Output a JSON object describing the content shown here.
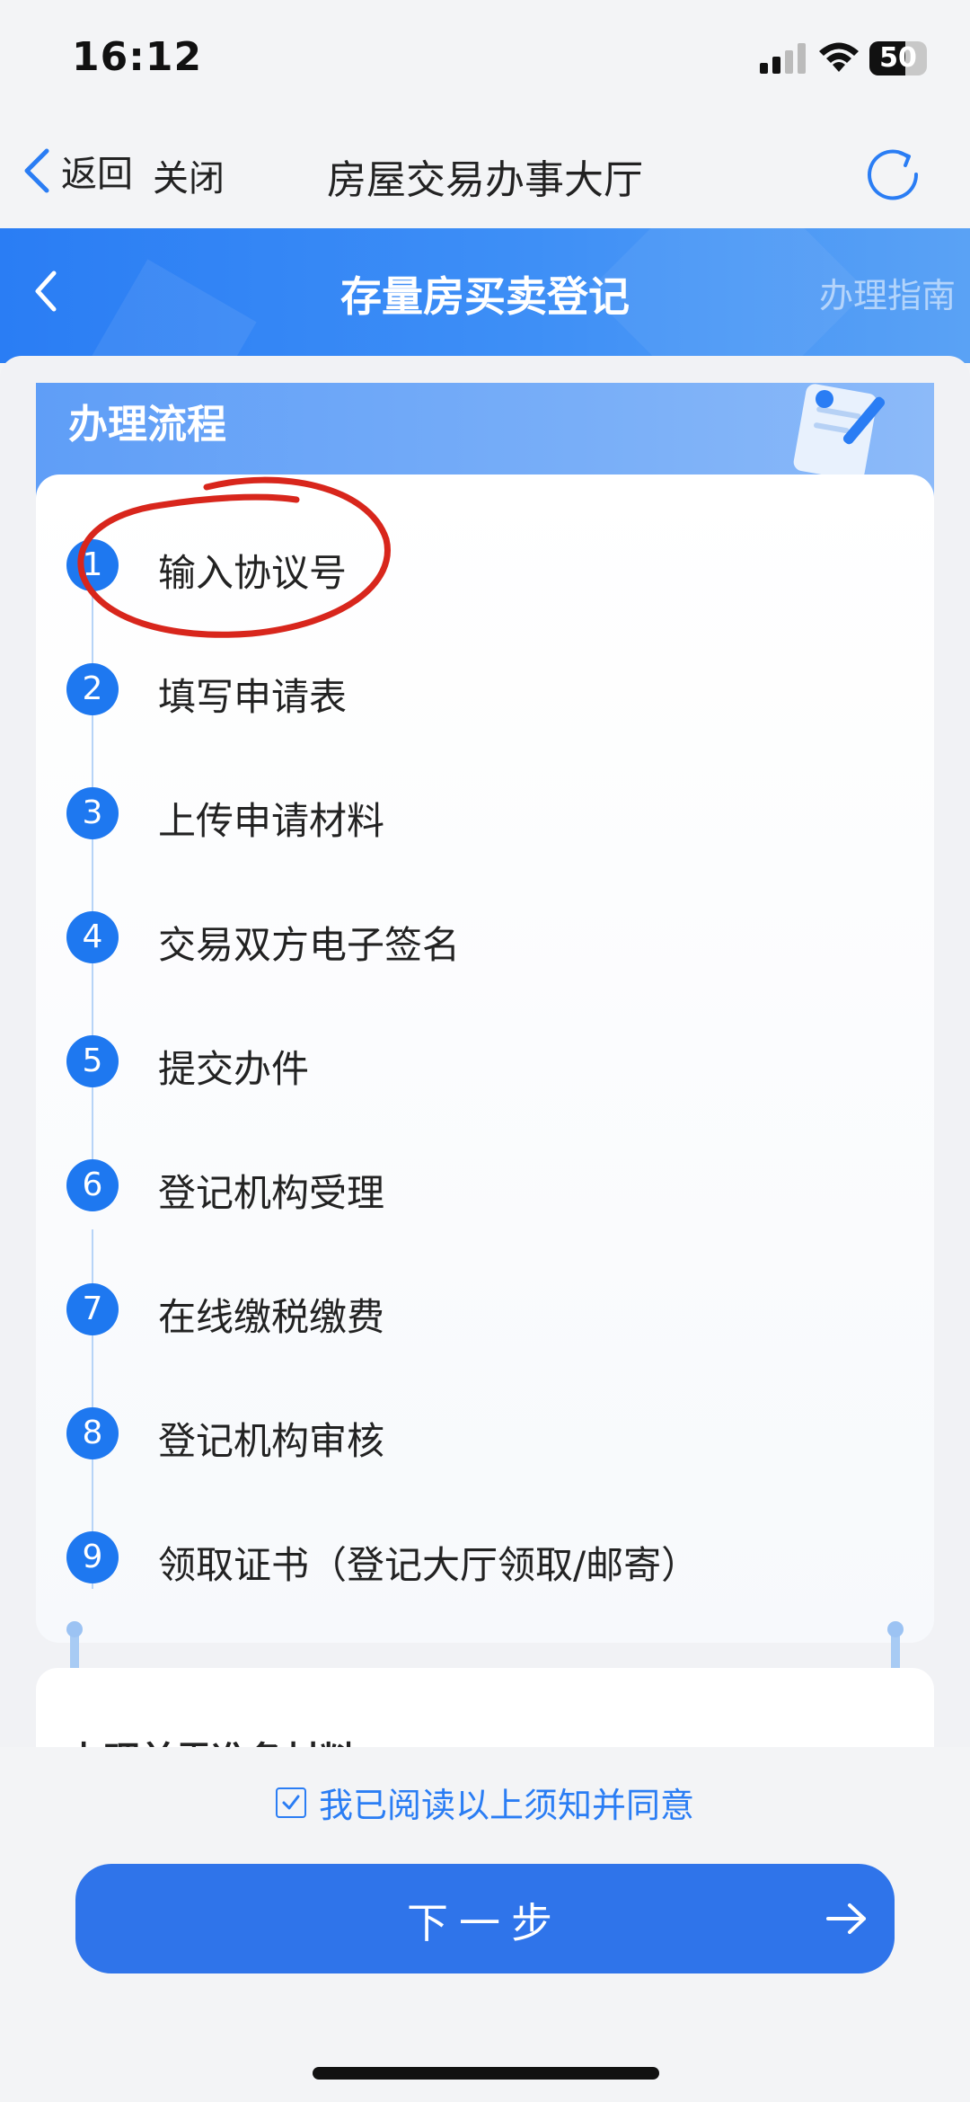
{
  "status_bar": {
    "time": "16:12",
    "battery": "50"
  },
  "nav": {
    "back_label": "返回",
    "close_label": "关闭",
    "title": "房屋交易办事大厅"
  },
  "header": {
    "title": "存量房买卖登记",
    "guide_label": "办理指南"
  },
  "process": {
    "title": "办理流程",
    "steps": [
      {
        "num": "1",
        "label": "输入协议号"
      },
      {
        "num": "2",
        "label": "填写申请表"
      },
      {
        "num": "3",
        "label": "上传申请材料"
      },
      {
        "num": "4",
        "label": "交易双方电子签名"
      },
      {
        "num": "5",
        "label": "提交办件"
      },
      {
        "num": "6",
        "label": "登记机构受理"
      },
      {
        "num": "7",
        "label": "在线缴税缴费"
      },
      {
        "num": "8",
        "label": "登记机构审核"
      },
      {
        "num": "9",
        "label": "领取证书（登记大厅领取/邮寄）"
      }
    ]
  },
  "materials": {
    "title": "办理前需准备材料："
  },
  "footer": {
    "agree_text": "我已阅读以上须知并同意",
    "next_label": "下一步"
  },
  "colors": {
    "primary": "#2a7df4",
    "step_circle": "#1e78f0",
    "annotation": "#d8261c"
  },
  "icons": [
    "back-chevron-icon",
    "refresh-icon",
    "checkbox-icon",
    "arrow-right-icon",
    "clipboard-illustration"
  ]
}
